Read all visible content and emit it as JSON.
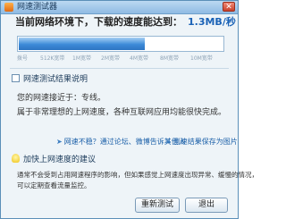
{
  "window": {
    "title": "网速测试器",
    "close_glyph": "✕"
  },
  "speed": {
    "label": "当前网络环境下，下载的速度能达到：",
    "value": "1.3MB/秒",
    "meter_fraction": 0.62
  },
  "scale_ticks": [
    "拨号",
    "512K宽带",
    "1M宽带",
    "2M宽带",
    "4M宽带",
    "8M宽带",
    "10M宽带"
  ],
  "results": {
    "header": "网速测试结果说明",
    "line1": "您的网速接近于：专线。",
    "line2": "属于非常理想的上网速度，各种互联网应用均能很快完成。"
  },
  "links": {
    "slow": "网速不稳？通过论坛、微博告诉其他人",
    "save": "测速结果保存为图片"
  },
  "advice": {
    "header": "加快上网速度的建议",
    "line1": "通常不会受到占用网速程序的影响，但如果感觉上网速度出现异常、缓慢的情况，",
    "line2": "可以定期查看流量监控。"
  },
  "buttons": {
    "retest": "重新测试",
    "exit": "退出"
  }
}
